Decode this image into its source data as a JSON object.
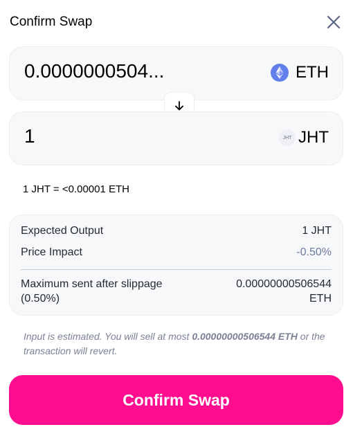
{
  "header": {
    "title": "Confirm Swap"
  },
  "input": {
    "amount": "0.0000000504...",
    "symbol": "ETH",
    "icon": "ethereum-icon"
  },
  "output": {
    "amount": "1",
    "symbol": "JHT",
    "logo_text": "JHT",
    "icon": "jht-token-icon"
  },
  "rate": "1 JHT = <0.00001 ETH",
  "details": {
    "expected_output_label": "Expected Output",
    "expected_output_value": "1 JHT",
    "price_impact_label": "Price Impact",
    "price_impact_value": "-0.50%",
    "max_sent_label_line1": "Maximum sent after slippage",
    "max_sent_label_line2": "(0.50%)",
    "max_sent_value_line1": "0.00000000506544",
    "max_sent_value_line2": "ETH"
  },
  "note": {
    "prefix": "Input is estimated. You will sell at most ",
    "amount": "0.00000000506544 ETH",
    "suffix": " or the transaction will revert."
  },
  "confirm_button": "Confirm Swap",
  "colors": {
    "accent": "#fe0d8e",
    "panel_bg": "#f7f8fa",
    "muted_value": "#6c7aa0",
    "eth_blue": "#627eea"
  }
}
